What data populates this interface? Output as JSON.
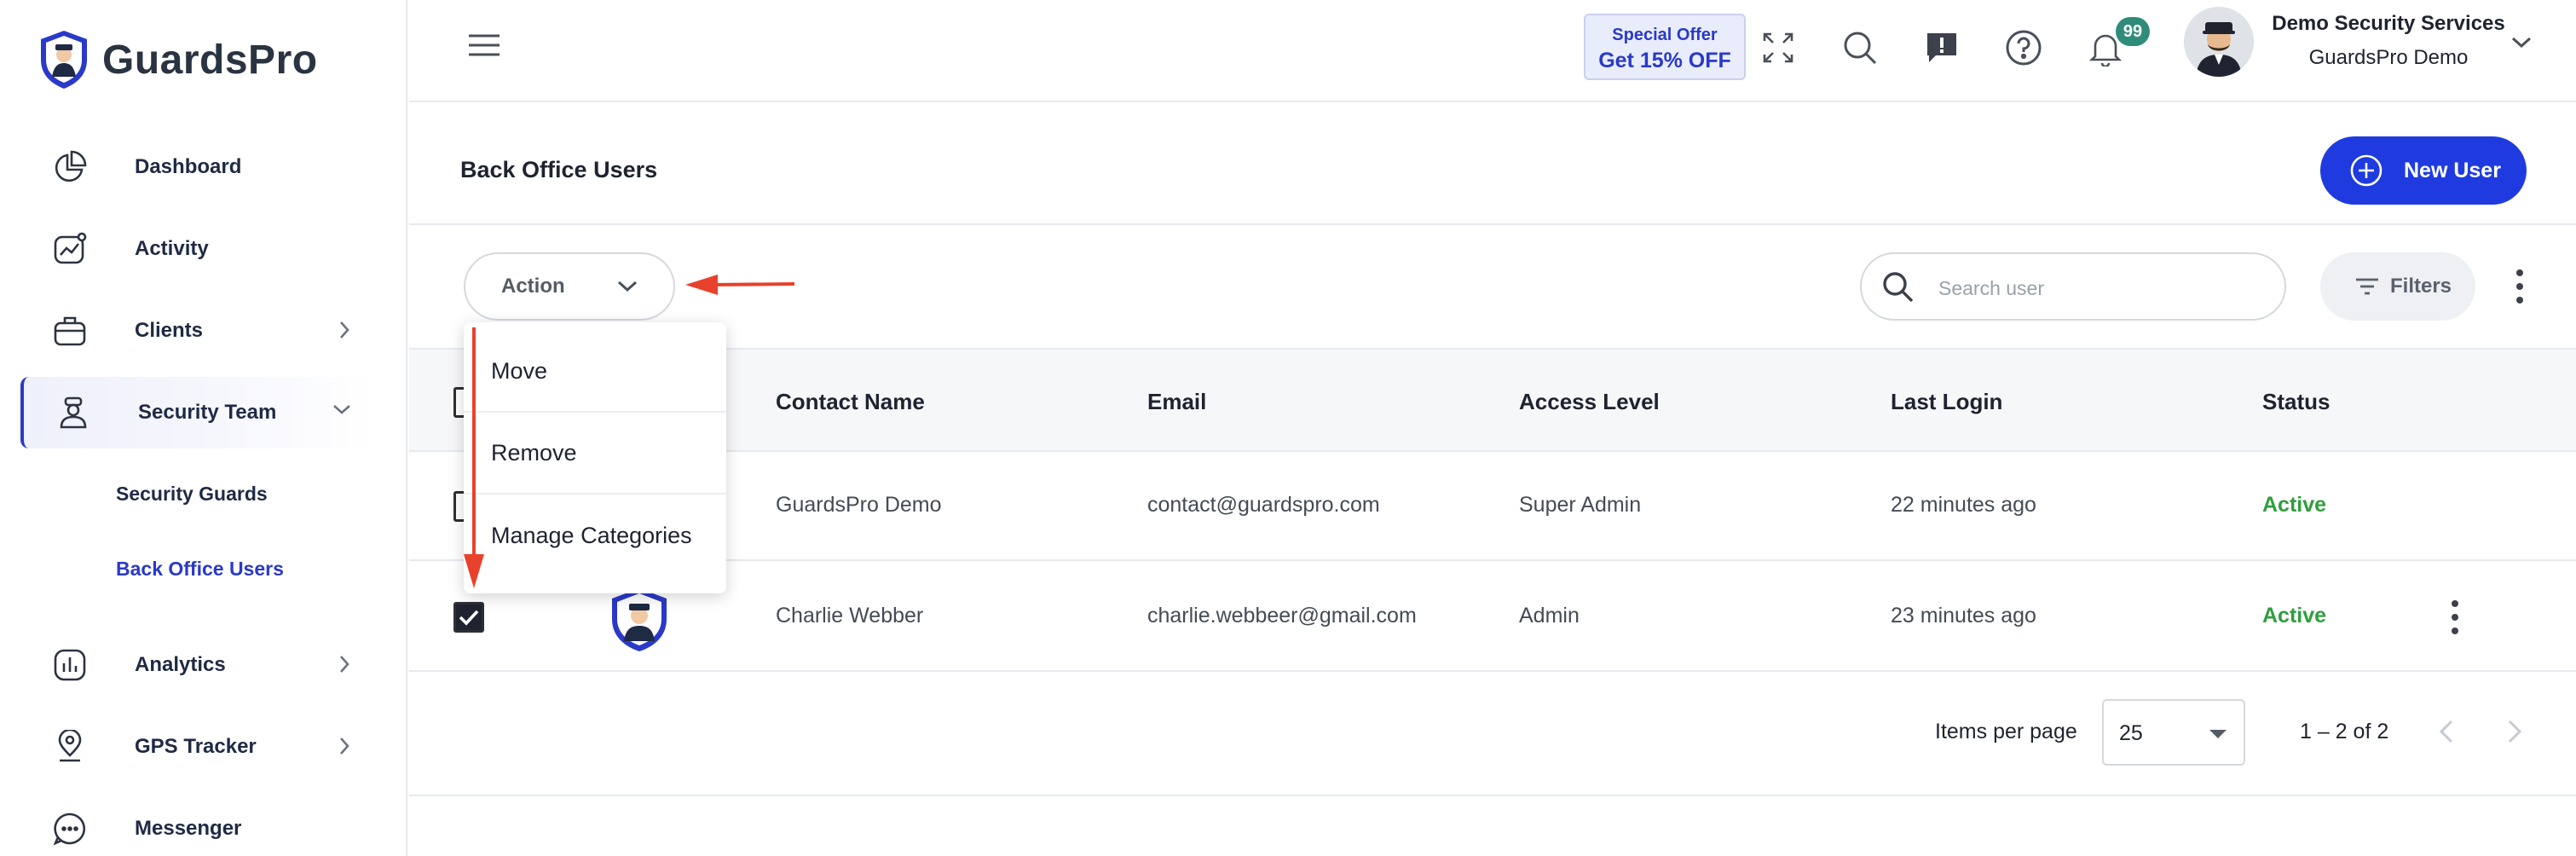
{
  "app": {
    "name": "GuardsPro"
  },
  "sidebar": {
    "items": [
      {
        "label": "Dashboard",
        "icon": "pie-chart-icon"
      },
      {
        "label": "Activity",
        "icon": "activity-icon"
      },
      {
        "label": "Clients",
        "icon": "briefcase-icon"
      },
      {
        "label": "Security Team",
        "icon": "guard-icon"
      },
      {
        "label": "Analytics",
        "icon": "analytics-icon"
      },
      {
        "label": "GPS Tracker",
        "icon": "location-pin-icon"
      },
      {
        "label": "Messenger",
        "icon": "chat-icon"
      }
    ],
    "subitems": [
      {
        "label": "Security Guards"
      },
      {
        "label": "Back Office Users"
      }
    ]
  },
  "topbar": {
    "offer_line1": "Special Offer",
    "offer_line2": "Get 15% OFF",
    "notification_count": "99",
    "company_name": "Demo Security Services",
    "user_name": "GuardsPro Demo"
  },
  "page": {
    "title": "Back Office Users",
    "new_user_label": "New User",
    "action_label": "Action",
    "search_placeholder": "Search user",
    "filters_label": "Filters"
  },
  "menu": {
    "items": [
      "Move",
      "Remove",
      "Manage Categories"
    ]
  },
  "table": {
    "columns": [
      "Contact Name",
      "Email",
      "Access Level",
      "Last Login",
      "Status"
    ],
    "rows": [
      {
        "name": "GuardsPro Demo",
        "email": "contact@guardspro.com",
        "access": "Super Admin",
        "last_login": "22 minutes ago",
        "status": "Active"
      },
      {
        "name": "Charlie Webber",
        "email": "charlie.webbeer@gmail.com",
        "access": "Admin",
        "last_login": "23 minutes ago",
        "status": "Active"
      }
    ]
  },
  "pagination": {
    "items_per_page_label": "Items per page",
    "items_per_page": "25",
    "range": "1 – 2 of 2"
  },
  "colors": {
    "accent": "#1f3be0",
    "status_active": "#2f9e3e",
    "annotation": "#e8412c"
  }
}
